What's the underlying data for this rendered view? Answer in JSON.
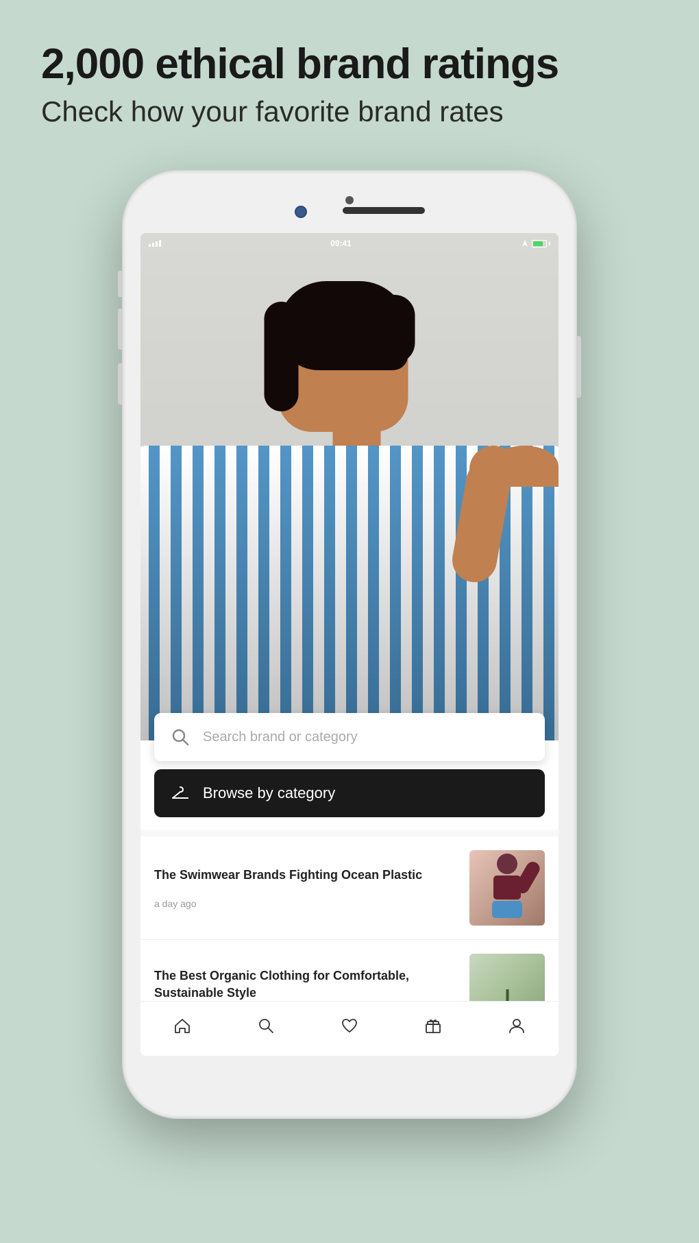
{
  "background_color": "#c5d9ce",
  "header": {
    "title": "2,000 ethical brand ratings",
    "subtitle": "Check how your favorite brand rates"
  },
  "phone": {
    "status_bar": {
      "time": "09:41",
      "signal": "●●●",
      "battery_level": 80
    },
    "search": {
      "placeholder": "Search brand or category",
      "icon": "search-icon"
    },
    "browse_button": {
      "label": "Browse by category",
      "icon": "hanger-icon"
    },
    "articles": [
      {
        "title": "The Swimwear Brands Fighting Ocean Plastic",
        "time": "a day ago",
        "thumbnail_type": "swimwear"
      },
      {
        "title": "The Best Organic Clothing for Comfortable, Sustainable Style",
        "time": "",
        "thumbnail_type": "clothing"
      }
    ],
    "bottom_nav": [
      {
        "icon": "home-icon",
        "label": ""
      },
      {
        "icon": "search-nav-icon",
        "label": ""
      },
      {
        "icon": "heart-icon",
        "label": ""
      },
      {
        "icon": "gift-icon",
        "label": ""
      },
      {
        "icon": "profile-icon",
        "label": ""
      }
    ]
  }
}
